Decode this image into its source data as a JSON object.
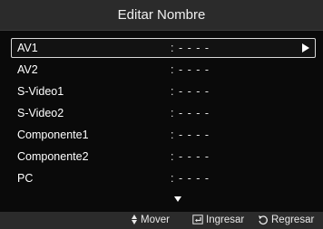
{
  "screen": {
    "title": "Editar Nombre"
  },
  "items": [
    {
      "label": "AV1",
      "value": ": - - - -"
    },
    {
      "label": "AV2",
      "value": ": - - - -"
    },
    {
      "label": "S-Video1",
      "value": ": - - - -"
    },
    {
      "label": "S-Video2",
      "value": ": - - - -"
    },
    {
      "label": "Componente1",
      "value": ": - - - -"
    },
    {
      "label": "Componente2",
      "value": ": - - - -"
    },
    {
      "label": "PC",
      "value": ": - - - -"
    }
  ],
  "footer": {
    "move": "Mover",
    "enter": "Ingresar",
    "back": "Regresar"
  },
  "icons": {
    "selected_row": "triangle-right-icon",
    "more": "triangle-down-icon",
    "move": "up-down-arrows-icon",
    "enter": "enter-icon",
    "back": "return-icon"
  }
}
